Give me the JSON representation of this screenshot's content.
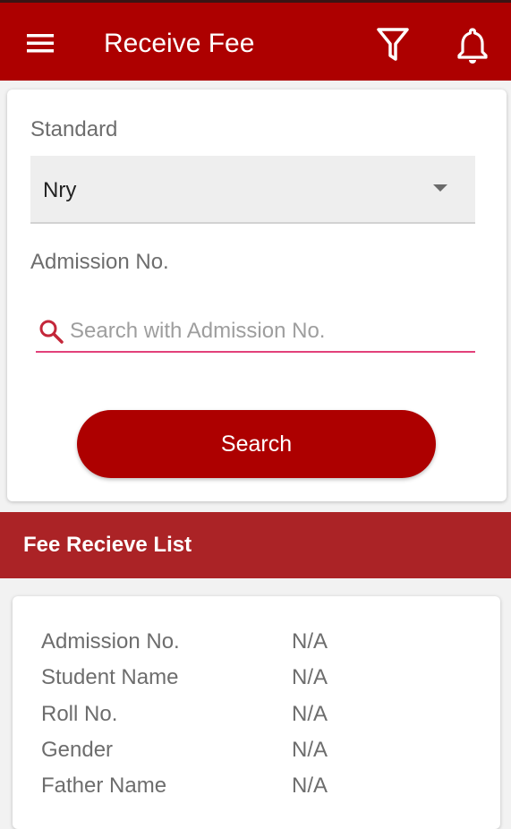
{
  "app_bar": {
    "title": "Receive Fee",
    "color": "#ad0000",
    "icons": [
      "menu-icon",
      "filter-icon",
      "bell-icon"
    ]
  },
  "form": {
    "standard_label": "Standard",
    "standard_value": "Nry",
    "admission_label": "Admission No.",
    "search_placeholder": "Search with Admission No.",
    "search_button": "Search"
  },
  "list": {
    "title": "Fee Recieve List",
    "header_color": "#ab2326",
    "rows": [
      {
        "label": "Admission No.",
        "value": "N/A"
      },
      {
        "label": "Student Name",
        "value": "N/A"
      },
      {
        "label": "Roll No.",
        "value": "N/A"
      },
      {
        "label": "Gender",
        "value": "N/A"
      },
      {
        "label": "Father Name",
        "value": "N/A"
      }
    ]
  },
  "colors": {
    "accent_underline": "#e2417a",
    "search_icon": "#c4273a"
  }
}
